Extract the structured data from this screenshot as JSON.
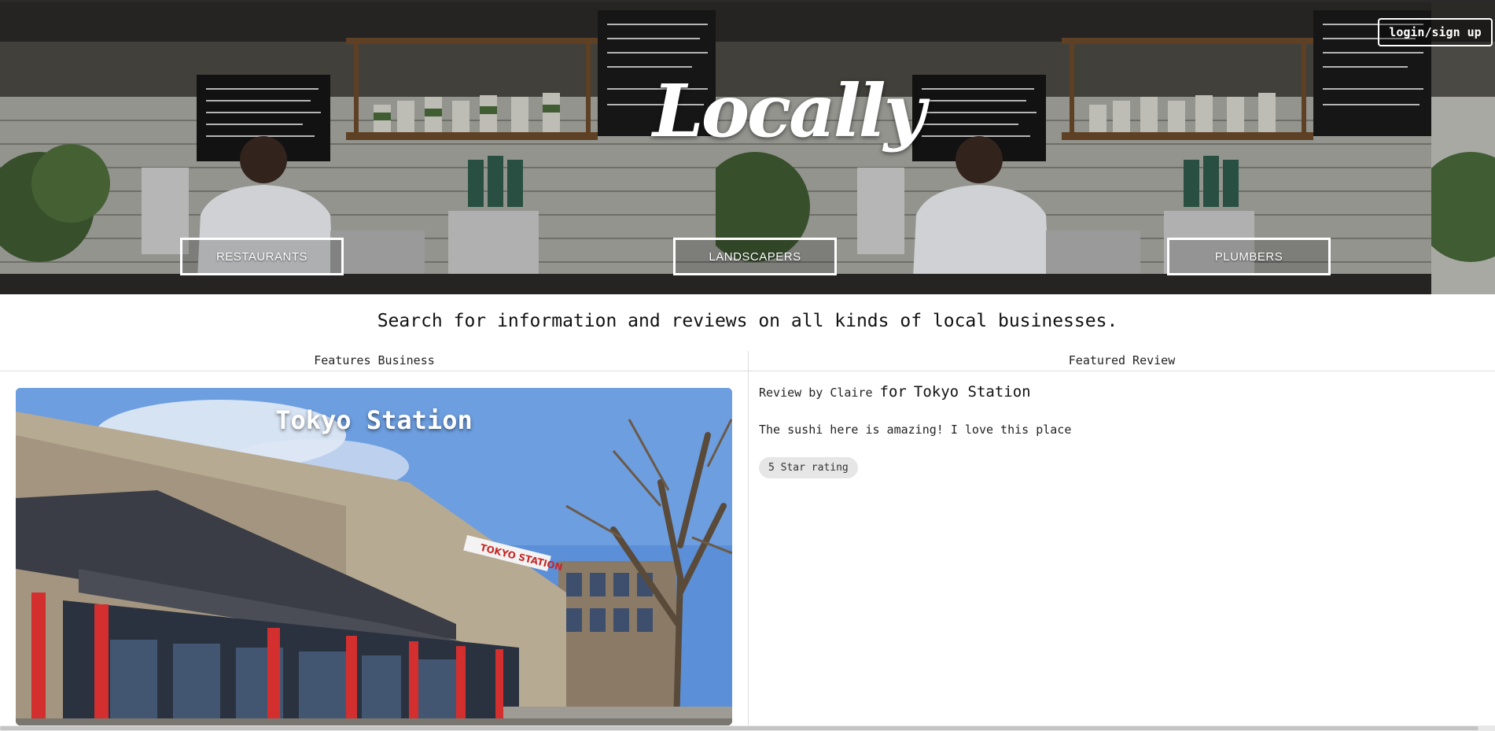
{
  "header": {
    "logo_text": "Locally",
    "login_label": "login/sign up",
    "categories": [
      {
        "label": "RESTAURANTS"
      },
      {
        "label": "LANDSCAPERS"
      },
      {
        "label": "PLUMBERS"
      }
    ]
  },
  "tagline": "Search for information and reviews on all kinds of local businesses.",
  "featured_business": {
    "section_title": "Features Business",
    "name": "Tokyo Station"
  },
  "featured_review": {
    "section_title": "Featured Review",
    "prefix": "Review by",
    "reviewer": "Claire",
    "for_word": "for",
    "business": "Tokyo Station",
    "text": "The sushi here is amazing! I love this place",
    "rating_badge": "5 Star rating"
  },
  "colors": {
    "accent_red": "#d32f2f",
    "sky_blue": "#5b8fd8",
    "badge_bg": "#e6e6e6"
  },
  "icons": {
    "hero_image": "coffee-shop-photo",
    "business_image": "restaurant-building-photo"
  }
}
